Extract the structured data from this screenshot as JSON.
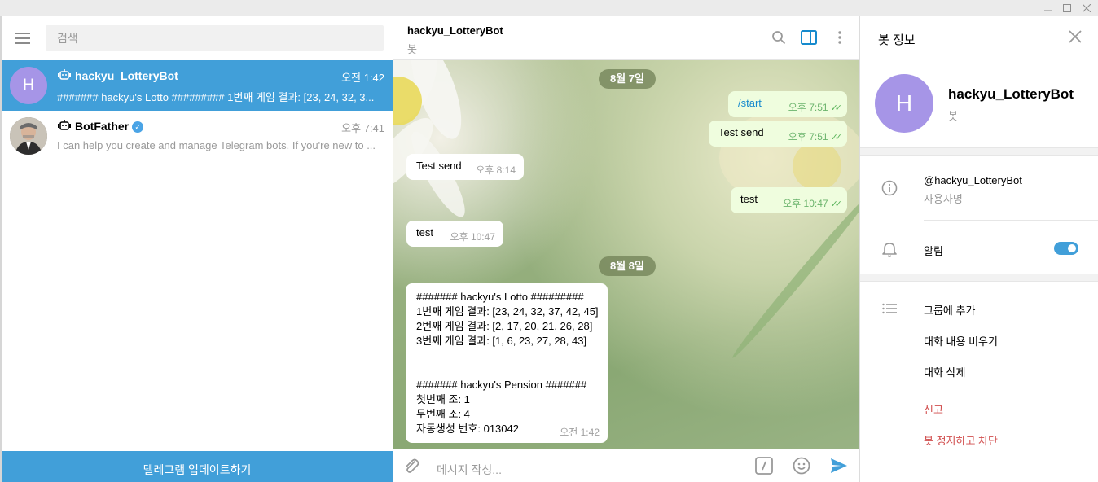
{
  "window": {
    "min": "—",
    "max": "☐",
    "close": "✕"
  },
  "sidebar": {
    "search_placeholder": "검색",
    "chats": [
      {
        "avatar_letter": "H",
        "avatar_color": "#a695e7",
        "name": "hackyu_LotteryBot",
        "time": "오전 1:42",
        "preview": "####### hackyu's Lotto ######### 1번째 게임 결과: [23, 24, 32, 3..."
      },
      {
        "name": "BotFather",
        "time": "오후 7:41",
        "preview": "I can help you create and manage Telegram bots. If you're new to ..."
      }
    ],
    "update_button": "텔레그램 업데이트하기"
  },
  "chat": {
    "title": "hackyu_LotteryBot",
    "subtitle": "봇",
    "dates": [
      "8월 7일",
      "8월 8일"
    ],
    "messages": [
      {
        "text": "/start",
        "time": "오후 7:51"
      },
      {
        "text": "Test send",
        "time": "오후 7:51"
      },
      {
        "text": "Test send",
        "time": "오후 8:14"
      },
      {
        "text": "test",
        "time": "오후 10:47"
      },
      {
        "text": "test",
        "time": "오후 10:47"
      }
    ],
    "lotto": {
      "lines": [
        "####### hackyu's Lotto #########",
        "1번째 게임 결과: [23, 24, 32, 37, 42, 45]",
        "2번째 게임 결과: [2, 17, 20, 21, 26, 28]",
        "3번째 게임 결과: [1, 6, 23, 27, 28, 43]",
        "",
        "",
        "####### hackyu's Pension #######",
        "첫번째 조: 1",
        "두번째 조: 4",
        "자동생성 번호: 013042"
      ],
      "time": "오전 1:42"
    },
    "composer_placeholder": "메시지 작성..."
  },
  "info": {
    "title": "봇 정보",
    "avatar_letter": "H",
    "name": "hackyu_LotteryBot",
    "subtitle": "봇",
    "username": "@hackyu_LotteryBot",
    "username_label": "사용자명",
    "notifications": "알림",
    "actions": [
      "그룹에 추가",
      "대화 내용 비우기",
      "대화 삭제"
    ],
    "report": "신고",
    "block": "봇 정지하고 차단"
  }
}
